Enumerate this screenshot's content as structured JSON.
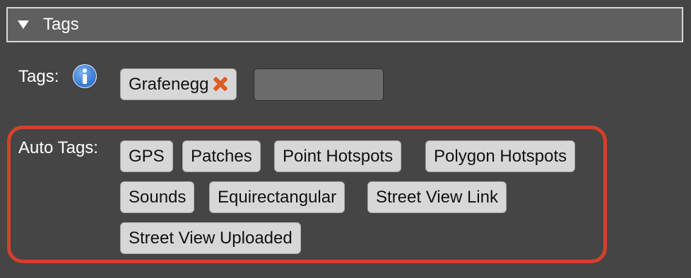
{
  "section": {
    "title": "Tags",
    "expand_icon": "disclosure-triangle-down-icon"
  },
  "tags": {
    "label": "Tags:",
    "info_icon": "info-icon",
    "items": [
      {
        "label": "Grafenegg",
        "remove_icon": "remove-x-icon"
      }
    ],
    "combo": {
      "value": "",
      "dropdown_icon": "chevron-down-icon"
    }
  },
  "auto_tags": {
    "label": "Auto Tags:",
    "items": [
      {
        "label": "GPS"
      },
      {
        "label": "Patches"
      },
      {
        "label": "Point Hotspots"
      },
      {
        "label": "Polygon Hotspots"
      },
      {
        "label": "Sounds"
      },
      {
        "label": "Equirectangular"
      },
      {
        "label": "Street View Link"
      },
      {
        "label": "Street View Uploaded"
      }
    ],
    "highlight_color": "#d4402a"
  },
  "colors": {
    "background": "#454545",
    "header_background": "#5f5f5f",
    "chip_background": "#d7d7d7",
    "remove_accent": "#e05a24",
    "info_blue": "#3d7fd6"
  }
}
